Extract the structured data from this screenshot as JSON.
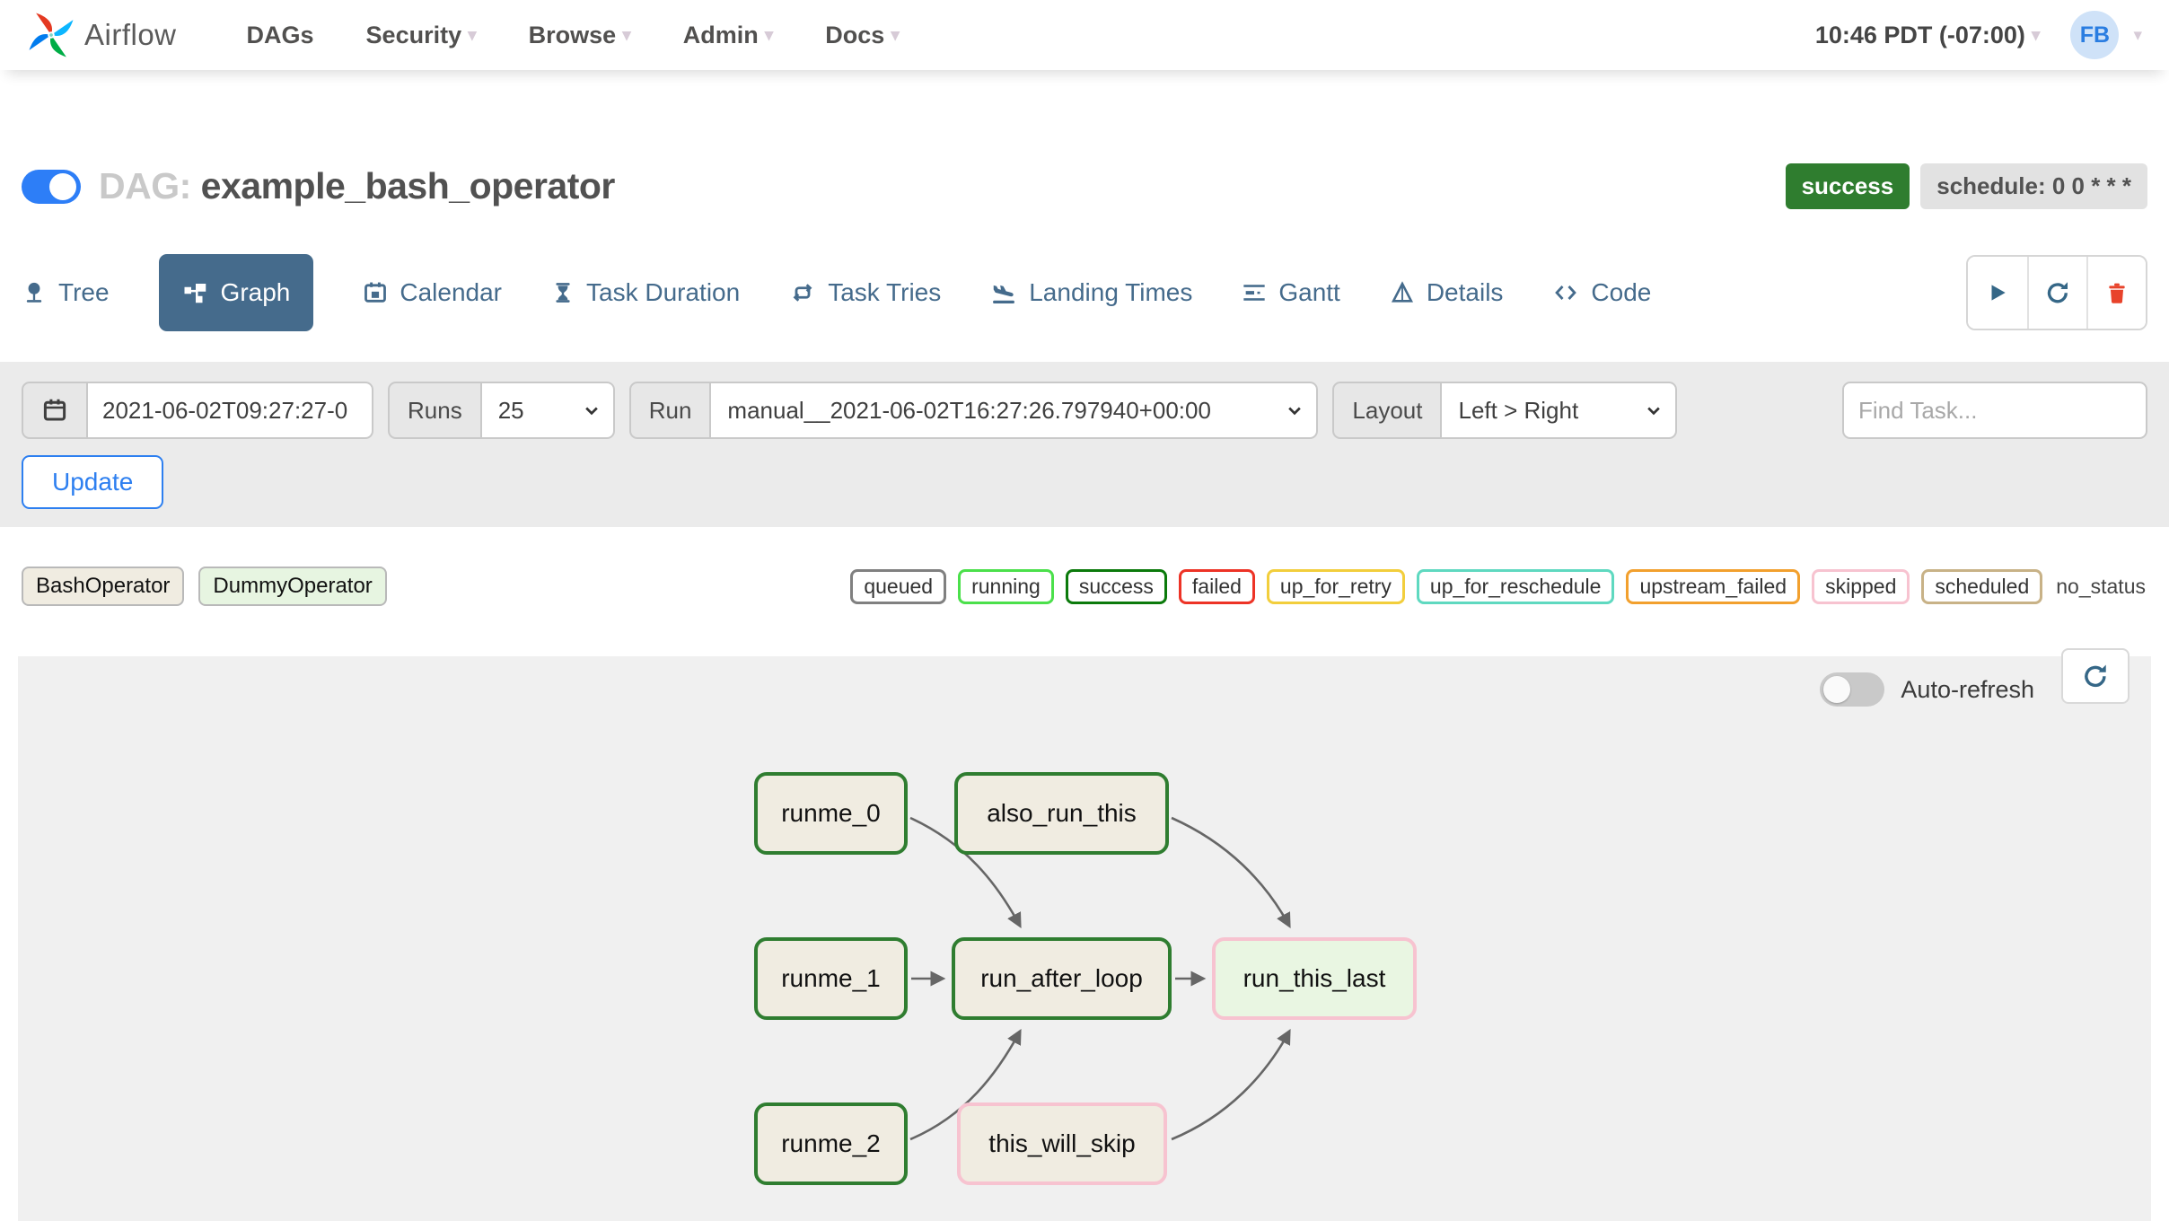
{
  "navbar": {
    "brand": "Airflow",
    "items": [
      {
        "label": "DAGs",
        "caret": false
      },
      {
        "label": "Security",
        "caret": true
      },
      {
        "label": "Browse",
        "caret": true
      },
      {
        "label": "Admin",
        "caret": true
      },
      {
        "label": "Docs",
        "caret": true
      }
    ],
    "clock": "10:46 PDT (-07:00)",
    "avatar_initials": "FB"
  },
  "dag_header": {
    "prefix": "DAG:",
    "name": "example_bash_operator",
    "status_badge": "success",
    "status_color": "#2f7d2f",
    "schedule_badge": "schedule: 0 0 * * *"
  },
  "tabs": [
    {
      "label": "Tree"
    },
    {
      "label": "Graph",
      "active": true
    },
    {
      "label": "Calendar"
    },
    {
      "label": "Task Duration"
    },
    {
      "label": "Task Tries"
    },
    {
      "label": "Landing Times"
    },
    {
      "label": "Gantt"
    },
    {
      "label": "Details"
    },
    {
      "label": "Code"
    }
  ],
  "filter_bar": {
    "date_value": "2021-06-02T09:27:27-0",
    "runs_label": "Runs",
    "runs_value": "25",
    "run_label": "Run",
    "run_value": "manual__2021-06-02T16:27:26.797940+00:00",
    "layout_label": "Layout",
    "layout_value": "Left > Right",
    "find_task_placeholder": "Find Task...",
    "update_label": "Update"
  },
  "legend": {
    "operators": [
      {
        "label": "BashOperator",
        "fill": "#f0ece1"
      },
      {
        "label": "DummyOperator",
        "fill": "#e7f5e1"
      }
    ],
    "statuses": [
      {
        "label": "queued",
        "color": "#808080"
      },
      {
        "label": "running",
        "color": "#4be04b"
      },
      {
        "label": "success",
        "color": "#0b7a0b"
      },
      {
        "label": "failed",
        "color": "#ed3326"
      },
      {
        "label": "up_for_retry",
        "color": "#f2ce3c"
      },
      {
        "label": "up_for_reschedule",
        "color": "#5fd9c0"
      },
      {
        "label": "upstream_failed",
        "color": "#f2a02e"
      },
      {
        "label": "skipped",
        "color": "#f7c3d0"
      },
      {
        "label": "scheduled",
        "color": "#c8b287"
      },
      {
        "label": "no_status",
        "color": ""
      }
    ]
  },
  "graph": {
    "auto_refresh_label": "Auto-refresh",
    "nodes": [
      {
        "label": "runme_0",
        "border": "#2f7d30",
        "fill": "#f0ece1"
      },
      {
        "label": "also_run_this",
        "border": "#2f7d30",
        "fill": "#f0ece1"
      },
      {
        "label": "runme_1",
        "border": "#2f7d30",
        "fill": "#f0ece1"
      },
      {
        "label": "run_after_loop",
        "border": "#2f7d30",
        "fill": "#f0ece1"
      },
      {
        "label": "run_this_last",
        "border": "#f7c3d0",
        "fill": "#e9f6e2"
      },
      {
        "label": "runme_2",
        "border": "#2f7d30",
        "fill": "#f0ece1"
      },
      {
        "label": "this_will_skip",
        "border": "#f7c3d0",
        "fill": "#f0ece1"
      }
    ]
  }
}
